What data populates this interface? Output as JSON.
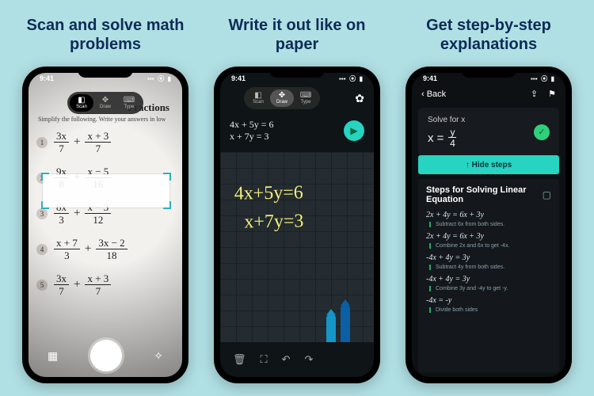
{
  "status": {
    "time": "9:41",
    "sig": "▪▪▪",
    "wifi": "⦿",
    "batt": "▮"
  },
  "panels": [
    {
      "headline": "Scan and solve math problems"
    },
    {
      "headline": "Write it out like on paper"
    },
    {
      "headline": "Get step-by-step explanations"
    }
  ],
  "segmented": {
    "scan": {
      "icon": "◧",
      "label": "Scan"
    },
    "draw": {
      "icon": "✥",
      "label": "Draw"
    },
    "type": {
      "icon": "⌨",
      "label": "Type"
    }
  },
  "screen1": {
    "worksheet_title": "Fractions",
    "instruction": "Simplify the following. Write your answers in low",
    "rows": [
      {
        "n": "1",
        "a_top": "3x",
        "a_bot": "7",
        "op": "+",
        "b_top": "x + 3",
        "b_bot": "7"
      },
      {
        "n": "2",
        "a_top": "9x",
        "a_bot": "8",
        "op": "+",
        "b_top": "x − 5",
        "b_bot": "16"
      },
      {
        "n": "3",
        "a_top": "8x",
        "a_bot": "3",
        "op": "+",
        "b_top": "x − 3",
        "b_bot": "12"
      },
      {
        "n": "4",
        "a_top": "x + 7",
        "a_bot": "3",
        "op": "+",
        "b_top": "3x − 2",
        "b_bot": "18"
      },
      {
        "n": "5",
        "a_top": "3x",
        "a_bot": "7",
        "op": "+",
        "b_top": "x + 3",
        "b_bot": "7"
      }
    ],
    "flash_off_icon": "✧"
  },
  "screen2": {
    "gear_icon": "✿",
    "typed_line1": "4x + 5y = 6",
    "typed_line2": "x + 7y = 3",
    "send_icon": "▶",
    "hand_line1": "4x+5y=6",
    "hand_line2": "x+7y=3",
    "toolbar": {
      "trash": "🗑",
      "crop": "⛶",
      "undo": "↶",
      "redo": "↷"
    }
  },
  "screen3": {
    "back": "‹ Back",
    "share_icon": "⇪",
    "bookmark_icon": "⚑",
    "solve_label": "Solve for x",
    "answer_lhs": "x =",
    "answer_top": "y",
    "answer_bot": "4",
    "check_icon": "✓",
    "hide_steps": "↑  Hide steps",
    "steps_title": "Steps for Solving Linear Equation",
    "book_icon": "▢",
    "steps": [
      {
        "eq": "2x + 4y = 6x + 3y",
        "note": "Subtract 6x from both sides."
      },
      {
        "eq": "2x + 4y = 6x + 3y",
        "note": "Combine 2x and 6x to get -4x."
      },
      {
        "eq": "-4x + 4y = 3y",
        "note": "Subtract 4y from both sides."
      },
      {
        "eq": "-4x + 4y = 3y",
        "note": "Combine 3y and -4y to get -y."
      },
      {
        "eq": "-4x = -y",
        "note": "Divide both sides"
      }
    ]
  }
}
